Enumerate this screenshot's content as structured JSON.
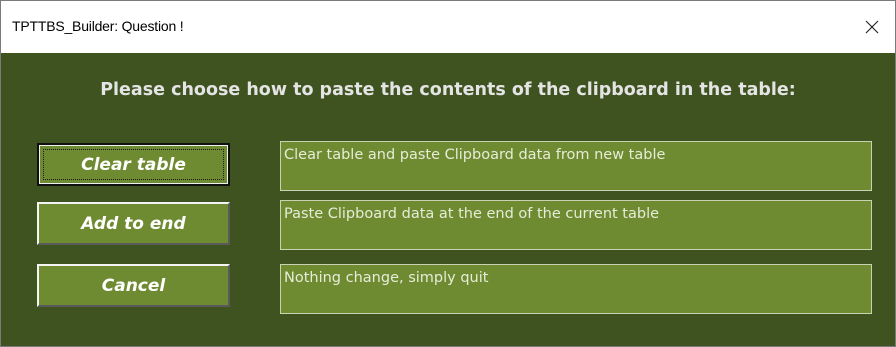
{
  "window": {
    "title": "TPTTBS_Builder: Question !",
    "close_glyph": "close-icon"
  },
  "prompt": "Please choose how to paste the contents of the clipboard in the table:",
  "options": [
    {
      "button_label": "Clear table",
      "description": "Clear table and paste Clipboard data from new table",
      "is_default": true
    },
    {
      "button_label": "Add to end",
      "description": "Paste Clipboard data at the end of the current table",
      "is_default": false
    },
    {
      "button_label": "Cancel",
      "description": "Nothing change, simply quit",
      "is_default": false
    }
  ],
  "colors": {
    "background": "#3f5320",
    "button_fill": "#6f8b32",
    "text": "#ffffff"
  }
}
